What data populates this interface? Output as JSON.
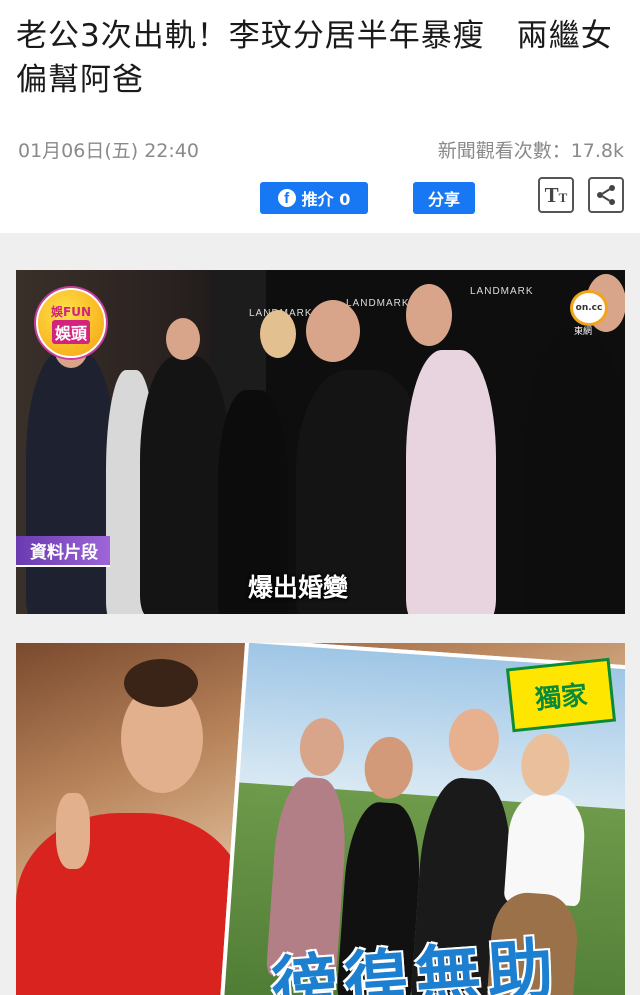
{
  "article": {
    "title": "老公3次出軌！李玟分居半年暴瘦　兩繼女偏幫阿爸",
    "date": "01月06日(五) 22:40",
    "views": "新聞觀看次數：17.8k"
  },
  "actions": {
    "like_icon": "f",
    "like_label": "推介 0",
    "share_label": "分享",
    "text_size_big": "T",
    "text_size_small": "T"
  },
  "photo1": {
    "badge_line1": "娛FUN",
    "badge_line2": "娛頭",
    "tag": "資料片段",
    "subtitle": "爆出婚變",
    "logo": "on.cc",
    "logo_label": "東網",
    "wall_text": [
      "LANDMARK",
      "LANDMARK",
      "LANDMARK"
    ]
  },
  "photo2": {
    "exclusive": "獨家",
    "caption": "徬徨無助"
  },
  "colors": {
    "accent": "#1877f2",
    "tag_purple": "#7b4bc4"
  }
}
